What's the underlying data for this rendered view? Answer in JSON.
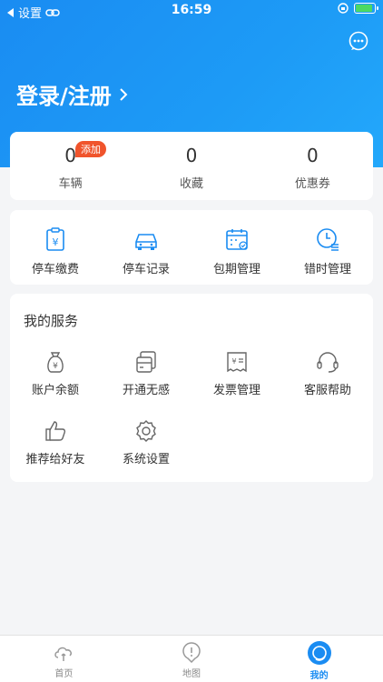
{
  "status_bar": {
    "back_label": "设置",
    "time": "16:59"
  },
  "header": {
    "login_label": "登录/注册"
  },
  "stats": [
    {
      "value": "0",
      "label": "车辆",
      "badge": "添加"
    },
    {
      "value": "0",
      "label": "收藏"
    },
    {
      "value": "0",
      "label": "优惠券"
    }
  ],
  "quick_actions": [
    {
      "label": "停车缴费",
      "icon": "parking-pay-icon"
    },
    {
      "label": "停车记录",
      "icon": "car-icon"
    },
    {
      "label": "包期管理",
      "icon": "calendar-icon"
    },
    {
      "label": "错时管理",
      "icon": "clock-icon"
    }
  ],
  "services": {
    "title": "我的服务",
    "items": [
      {
        "label": "账户余额",
        "icon": "money-bag-icon"
      },
      {
        "label": "开通无感",
        "icon": "card-icon"
      },
      {
        "label": "发票管理",
        "icon": "invoice-icon"
      },
      {
        "label": "客服帮助",
        "icon": "headset-icon"
      },
      {
        "label": "推荐给好友",
        "icon": "thumbs-up-icon"
      },
      {
        "label": "系统设置",
        "icon": "settings-icon"
      }
    ]
  },
  "tabbar": [
    {
      "label": "首页",
      "icon": "home-cloud-icon",
      "active": false
    },
    {
      "label": "地图",
      "icon": "map-pin-icon",
      "active": false
    },
    {
      "label": "我的",
      "icon": "profile-icon",
      "active": true
    }
  ],
  "colors": {
    "primary": "#1a8cf2",
    "badge": "#f0542c",
    "background": "#f4f5f7"
  }
}
